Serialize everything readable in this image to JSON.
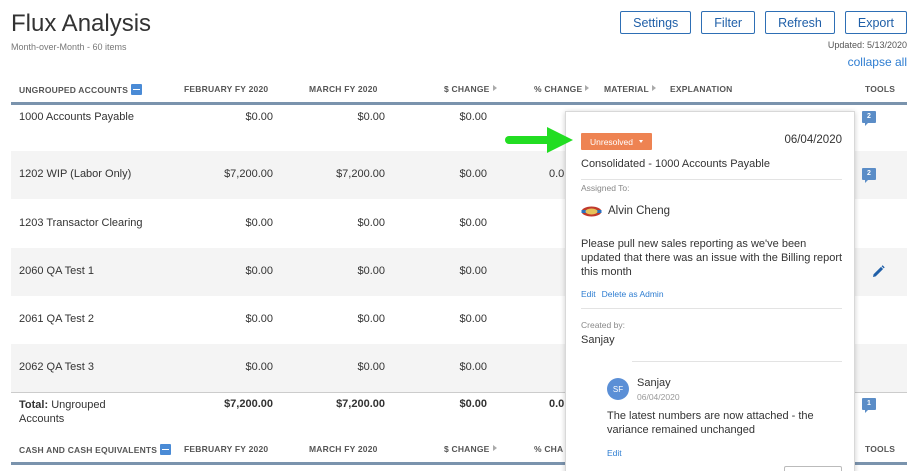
{
  "header": {
    "title": "Flux Analysis",
    "subtitle": "Month-over-Month - 60 items",
    "updated": "Updated: 5/13/2020",
    "collapse_all": "collapse all"
  },
  "toolbar": {
    "settings": "Settings",
    "filter": "Filter",
    "refresh": "Refresh",
    "export": "Export"
  },
  "table": {
    "group1": {
      "headers": {
        "accounts": "UNGROUPED ACCOUNTS",
        "col1": "FEBRUARY FY 2020",
        "col2": "MARCH FY 2020",
        "col3": "$ CHANGE",
        "col4": "% CHANGE",
        "col5": "MATERIAL",
        "col6": "EXPLANATION",
        "col7": "TOOLS"
      },
      "rows": [
        {
          "account": "1000 Accounts Payable",
          "feb": "$0.00",
          "mar": "$0.00",
          "change": "$0.00",
          "pct": "",
          "comments": "2"
        },
        {
          "account": "1202 WIP (Labor Only)",
          "feb": "$7,200.00",
          "mar": "$7,200.00",
          "change": "$0.00",
          "pct": "0.0",
          "comments": "2"
        },
        {
          "account": "1203 Transactor Clearing",
          "feb": "$0.00",
          "mar": "$0.00",
          "change": "$0.00",
          "pct": "",
          "comments": ""
        },
        {
          "account": "2060 QA Test 1",
          "feb": "$0.00",
          "mar": "$0.00",
          "change": "$0.00",
          "pct": "",
          "comments": ""
        },
        {
          "account": "2061 QA Test 2",
          "feb": "$0.00",
          "mar": "$0.00",
          "change": "$0.00",
          "pct": "",
          "comments": ""
        },
        {
          "account": "2062 QA Test 3",
          "feb": "$0.00",
          "mar": "$0.00",
          "change": "$0.00",
          "pct": "",
          "comments": ""
        }
      ],
      "total": {
        "label_bold": "Total:",
        "label_rest": "Ungrouped Accounts",
        "feb": "$7,200.00",
        "mar": "$7,200.00",
        "change": "$0.00",
        "pct": "0.0",
        "comments": "1"
      }
    },
    "group2": {
      "headers": {
        "accounts": "CASH AND CASH EQUIVALENTS",
        "col1": "FEBRUARY FY 2020",
        "col2": "MARCH FY 2020",
        "col3": "$ CHANGE",
        "col4": "% CHA",
        "col7": "TOOLS"
      }
    }
  },
  "popover": {
    "status": "Unresolved",
    "date": "06/04/2020",
    "context": "Consolidated - 1000 Accounts Payable",
    "assigned_label": "Assigned To:",
    "assignee": "Alvin Cheng",
    "text": "Please pull new sales reporting as we've been updated that there was an issue with the Billing report this month",
    "edit": "Edit",
    "delete": "Delete as Admin",
    "created_label": "Created by:",
    "creator": "Sanjay",
    "reply": {
      "initials": "SF",
      "name": "Sanjay",
      "date": "06/04/2020",
      "text": "The latest numbers are now attached - the variance remained unchanged",
      "edit": "Edit"
    }
  },
  "colors": {
    "accent": "#2e6fb5",
    "status": "#ee8352",
    "arrow": "#22dd22",
    "header_bar": "#7a93ad"
  }
}
